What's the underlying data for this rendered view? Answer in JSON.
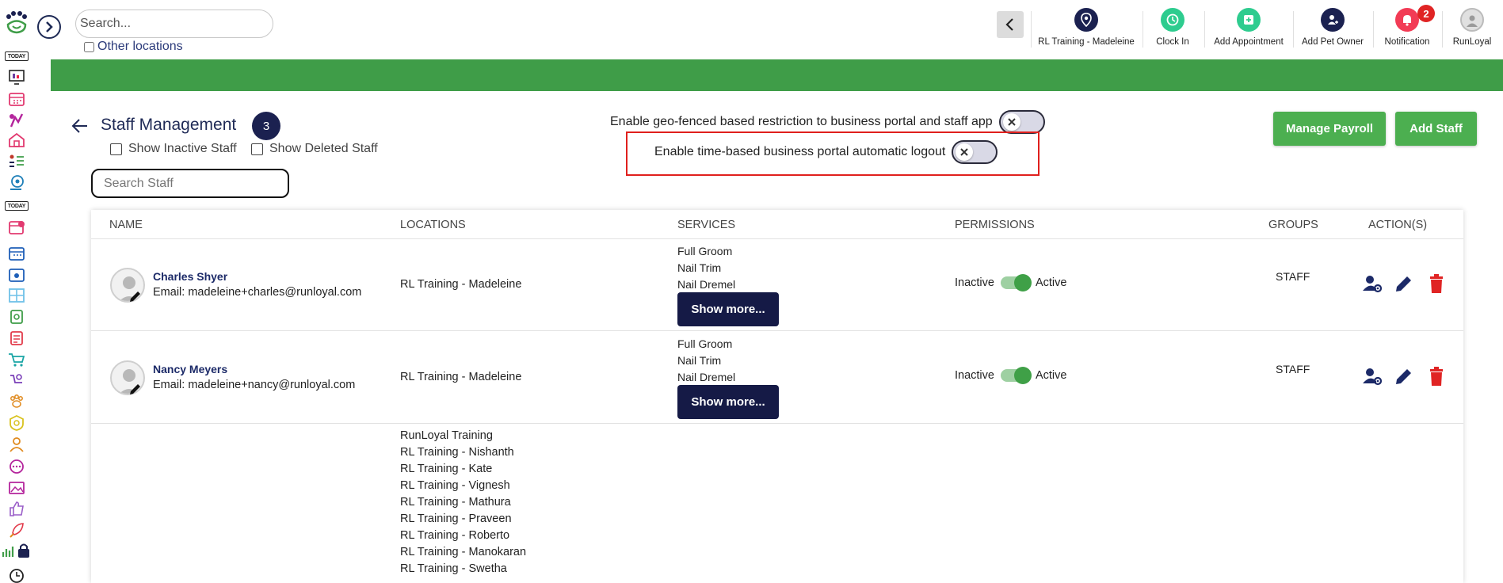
{
  "topbar": {
    "search_placeholder": "Search...",
    "other_locations_label": "Other locations",
    "actions": [
      {
        "label": "RL Training - Madeleine",
        "icon": "location-pin-icon",
        "color": "#1b2150"
      },
      {
        "label": "Clock In",
        "icon": "clock-icon",
        "color": "#2ecc8f"
      },
      {
        "label": "Add Appointment",
        "icon": "add-appointment-icon",
        "color": "#2ecc8f"
      },
      {
        "label": "Add Pet Owner",
        "icon": "add-user-icon",
        "color": "#1b2150"
      },
      {
        "label": "Notification",
        "icon": "bell-icon",
        "color": "#f23b55",
        "badge": "2"
      },
      {
        "label": "RunLoyal",
        "icon": "avatar-icon",
        "color": "#cccccc"
      }
    ]
  },
  "sidebar": {
    "today_label": "TODAY",
    "today2_label": "TODAY"
  },
  "colors": {
    "brand_green": "#3f9d48",
    "navy": "#1b2150",
    "button_green": "#4caf50",
    "danger": "#e02424",
    "highlight": "#e0201d"
  },
  "header": {
    "title": "Staff Management",
    "count": "3",
    "show_inactive_label": "Show Inactive Staff",
    "show_deleted_label": "Show Deleted Staff",
    "search_placeholder": "Search Staff",
    "geo_toggle_label": "Enable geo-fenced based restriction to business portal and staff app",
    "logout_toggle_label": "Enable time-based business portal automatic logout",
    "manage_payroll_label": "Manage Payroll",
    "add_staff_label": "Add Staff"
  },
  "table": {
    "columns": [
      "NAME",
      "LOCATIONS",
      "SERVICES",
      "PERMISSIONS",
      "GROUPS",
      "ACTION(S)"
    ],
    "rows": [
      {
        "name": "Charles Shyer",
        "email": "Email: madeleine+charles@runloyal.com",
        "location": "RL Training - Madeleine",
        "services": [
          "Full Groom",
          "Nail Trim",
          "Nail Dremel"
        ],
        "show_more": "Show more...",
        "perm_inactive": "Inactive",
        "perm_active": "Active",
        "group": "STAFF"
      },
      {
        "name": "Nancy Meyers",
        "email": "Email: madeleine+nancy@runloyal.com",
        "location": "RL Training - Madeleine",
        "services": [
          "Full Groom",
          "Nail Trim",
          "Nail Dremel"
        ],
        "show_more": "Show more...",
        "perm_inactive": "Inactive",
        "perm_active": "Active",
        "group": "STAFF"
      }
    ],
    "third_row_locations": [
      "RunLoyal Training",
      "RL Training - Nishanth",
      "RL Training - Kate",
      "RL Training - Vignesh",
      "RL Training - Mathura",
      "RL Training - Praveen",
      "RL Training - Roberto",
      "RL Training - Manokaran",
      "RL Training - Swetha"
    ]
  }
}
